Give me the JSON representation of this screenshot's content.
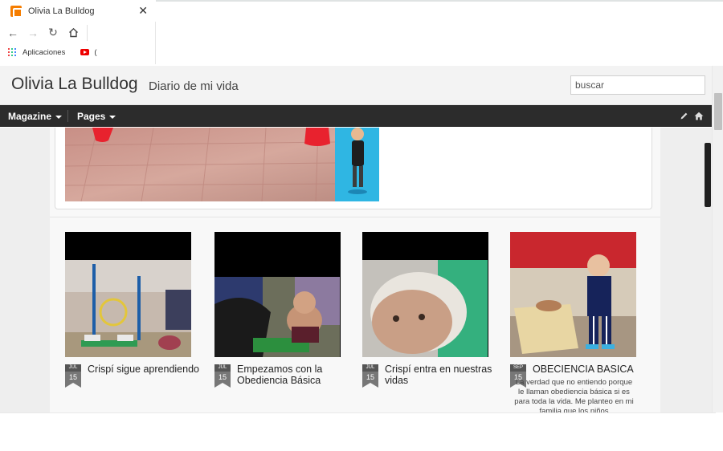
{
  "browser": {
    "tab_title": "Olivia La Bulldog",
    "bookmarks": {
      "apps_label": "Aplicaciones",
      "youtube_label": "("
    }
  },
  "blog": {
    "title": "Olivia La Bulldog",
    "description": "Diario de mi vida",
    "search_placeholder": "buscar"
  },
  "menu": {
    "items": [
      {
        "label": "Magazine"
      },
      {
        "label": "Pages"
      }
    ]
  },
  "posts": [
    {
      "month": "JUL",
      "day": "15",
      "title": "Crispí sigue aprendiendo",
      "excerpt": ""
    },
    {
      "month": "JUL",
      "day": "15",
      "title": "Empezamos con la Obediencia Básica",
      "excerpt": ""
    },
    {
      "month": "JUL",
      "day": "15",
      "title": "Crispí entra en nuestras vidas",
      "excerpt": ""
    },
    {
      "month": "SEP",
      "day": "15",
      "title": "OBECIENCIA BASICA",
      "excerpt": "La verdad que no entiendo porque le llaman obediencia básica si es para toda la vida. Me planteo en mi familia que los niños"
    }
  ],
  "colors": {
    "menubar": "#2c2c2c",
    "header_bg": "#f3f3f3",
    "page_bg": "#eeeeee",
    "date_badge": "#777777",
    "favicon": "#f57d00"
  }
}
